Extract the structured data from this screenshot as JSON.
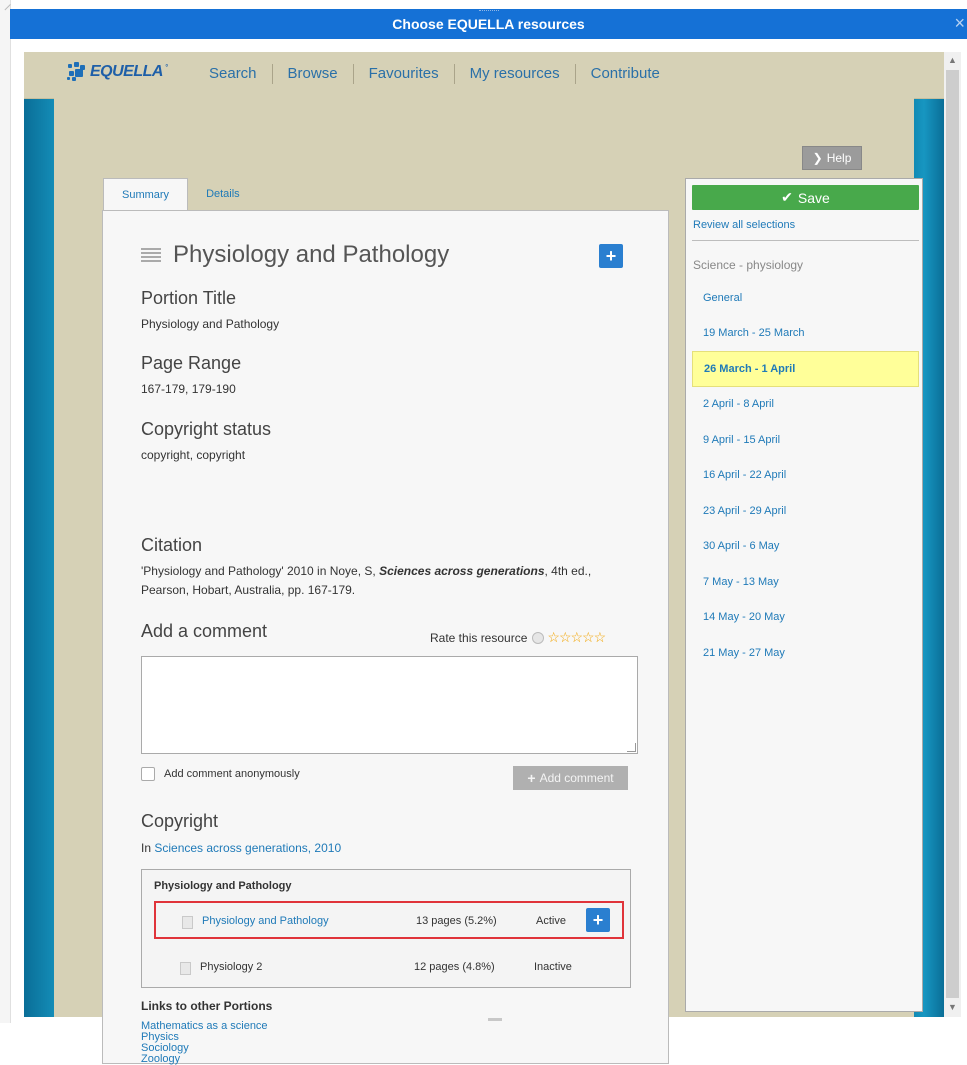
{
  "dialog": {
    "title": "Choose EQUELLA resources",
    "close": "×"
  },
  "header": {
    "logo": "EQUELLA",
    "nav": [
      "Search",
      "Browse",
      "Favourites",
      "My resources",
      "Contribute"
    ],
    "help": "Help"
  },
  "tabs": [
    "Summary",
    "Details"
  ],
  "resource": {
    "title": "Physiology and Pathology",
    "portion_title_label": "Portion Title",
    "portion_title": "Physiology and Pathology",
    "page_range_label": "Page Range",
    "page_range": "167-179, 179-190",
    "copyright_status_label": "Copyright status",
    "copyright_status": "copyright, copyright",
    "citation_label": "Citation",
    "citation_pre": "'Physiology and Pathology' 2010 in Noye, S, ",
    "citation_em": "Sciences across generations",
    "citation_post": ", 4th ed., Pearson, Hobart, Australia, pp. 167-179."
  },
  "comment": {
    "heading": "Add a comment",
    "rate_label": "Rate this resource",
    "stars": "☆☆☆☆☆",
    "text": "",
    "anonymous_label": "Add comment anonymously",
    "anonymous_checked": false,
    "add_button": "Add comment"
  },
  "copyright": {
    "heading": "Copyright",
    "in_prefix": "In ",
    "in_link": "Sciences across generations, 2010",
    "box_title": "Physiology and Pathology",
    "portions": [
      {
        "name": "Physiology and Pathology",
        "pages": "13 pages (5.2%)",
        "status": "Active",
        "is_link": true
      },
      {
        "name": "Physiology 2",
        "pages": "12 pages (4.8%)",
        "status": "Inactive",
        "is_link": false
      }
    ],
    "links_heading": "Links to other Portions",
    "links": [
      "Mathematics as a science",
      "Physics",
      "Sociology",
      "Zoology"
    ]
  },
  "sidebar": {
    "save": "Save",
    "review": "Review all selections",
    "course": "Science - physiology",
    "weeks": [
      "General",
      "19 March - 25 March",
      "26 March - 1 April",
      "2 April - 8 April",
      "9 April - 15 April",
      "16 April - 22 April",
      "23 April - 29 April",
      "30 April - 6 May",
      "7 May - 13 May",
      "14 May - 20 May",
      "21 May - 27 May"
    ],
    "selected_week_index": 2
  },
  "colors": {
    "titlebar": "#1571d6",
    "frame": "#0c7fa8",
    "content": "#d6d1b6",
    "link": "#1f7ab8",
    "save": "#48a94b",
    "selected_week": "#ffff99",
    "highlight_border": "#e0343a"
  }
}
